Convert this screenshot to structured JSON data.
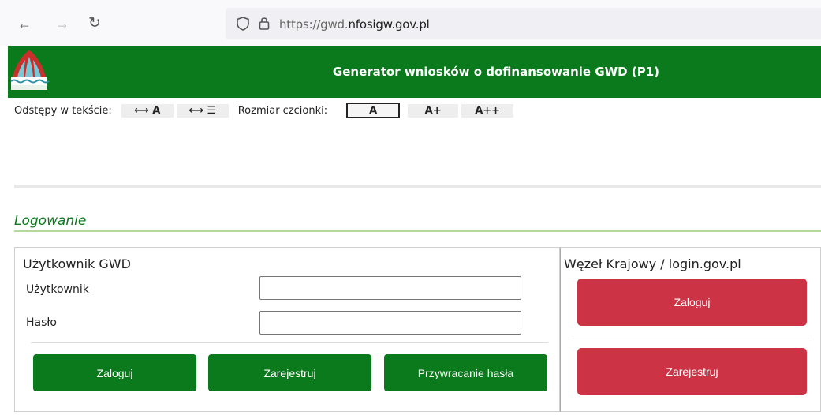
{
  "browser": {
    "url_prefix": "https://gwd.",
    "url_domain": "nfosigw.gov.pl",
    "icons": {
      "back": "back-arrow-icon",
      "forward": "forward-arrow-icon",
      "reload": "reload-icon",
      "shield": "shield-icon",
      "lock": "lock-icon"
    }
  },
  "header": {
    "title": "Generator wniosków o dofinansowanie GWD (P1)",
    "logo": "nfosigw-logo",
    "brand_color": "#0a7a1c"
  },
  "toolbar": {
    "spacing_label": "Odstępy w tekście:",
    "spacing_letters": "⟷ A",
    "spacing_lines": "⟷ ☰",
    "font_size_label": "Rozmiar czcionki:",
    "size_normal": "A",
    "size_large": "A+",
    "size_xlarge": "A++"
  },
  "section": {
    "title": "Logowanie"
  },
  "gwd_panel": {
    "title": "Użytkownik GWD",
    "user_label": "Użytkownik",
    "user_value": "",
    "password_label": "Hasło",
    "password_value": "",
    "login_button": "Zaloguj",
    "register_button": "Zarejestruj",
    "reset_button": "Przywracanie hasła"
  },
  "national_panel": {
    "title": "Węzeł Krajowy / login.gov.pl",
    "login_button": "Zaloguj",
    "register_button": "Zarejestruj",
    "accent_color": "#cc3446"
  }
}
